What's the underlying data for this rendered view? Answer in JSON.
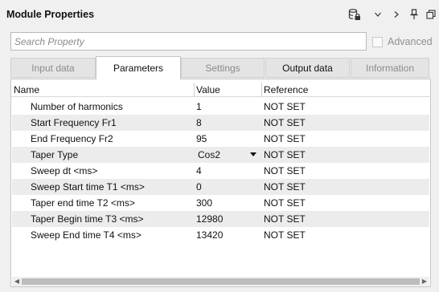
{
  "panel": {
    "title": "Module Properties",
    "toolbar_icons": [
      "database-lock-icon",
      "chevron-down-icon",
      "chevron-right-icon",
      "pin-icon",
      "restore-window-icon"
    ]
  },
  "search": {
    "placeholder": "Search Property",
    "value": ""
  },
  "advanced": {
    "label": "Advanced",
    "checked": false,
    "enabled": false
  },
  "tabs": [
    {
      "label": "Input data",
      "active": false,
      "enabled": false
    },
    {
      "label": "Parameters",
      "active": true,
      "enabled": true
    },
    {
      "label": "Settings",
      "active": false,
      "enabled": false
    },
    {
      "label": "Output data",
      "active": false,
      "enabled": true
    },
    {
      "label": "Information",
      "active": false,
      "enabled": false
    }
  ],
  "grid": {
    "columns": [
      "Name",
      "Value",
      "Reference"
    ],
    "rows": [
      {
        "name": "Number of harmonics",
        "value": "1",
        "reference": "NOT SET"
      },
      {
        "name": "Start Frequency Fr1",
        "value": "8",
        "reference": "NOT SET"
      },
      {
        "name": "End Frequency Fr2",
        "value": "95",
        "reference": "NOT SET"
      },
      {
        "name": "Taper Type",
        "value": "Cos2",
        "reference": "NOT SET",
        "dropdown": true
      },
      {
        "name": "Sweep dt <ms>",
        "value": "4",
        "reference": "NOT SET"
      },
      {
        "name": "Sweep Start time T1 <ms>",
        "value": "0",
        "reference": "NOT SET"
      },
      {
        "name": "Taper end time T2 <ms>",
        "value": "300",
        "reference": "NOT SET"
      },
      {
        "name": "Taper Begin time T3 <ms>",
        "value": "12980",
        "reference": "NOT SET"
      },
      {
        "name": "Sweep End time T4 <ms>",
        "value": "13420",
        "reference": "NOT SET"
      }
    ]
  }
}
